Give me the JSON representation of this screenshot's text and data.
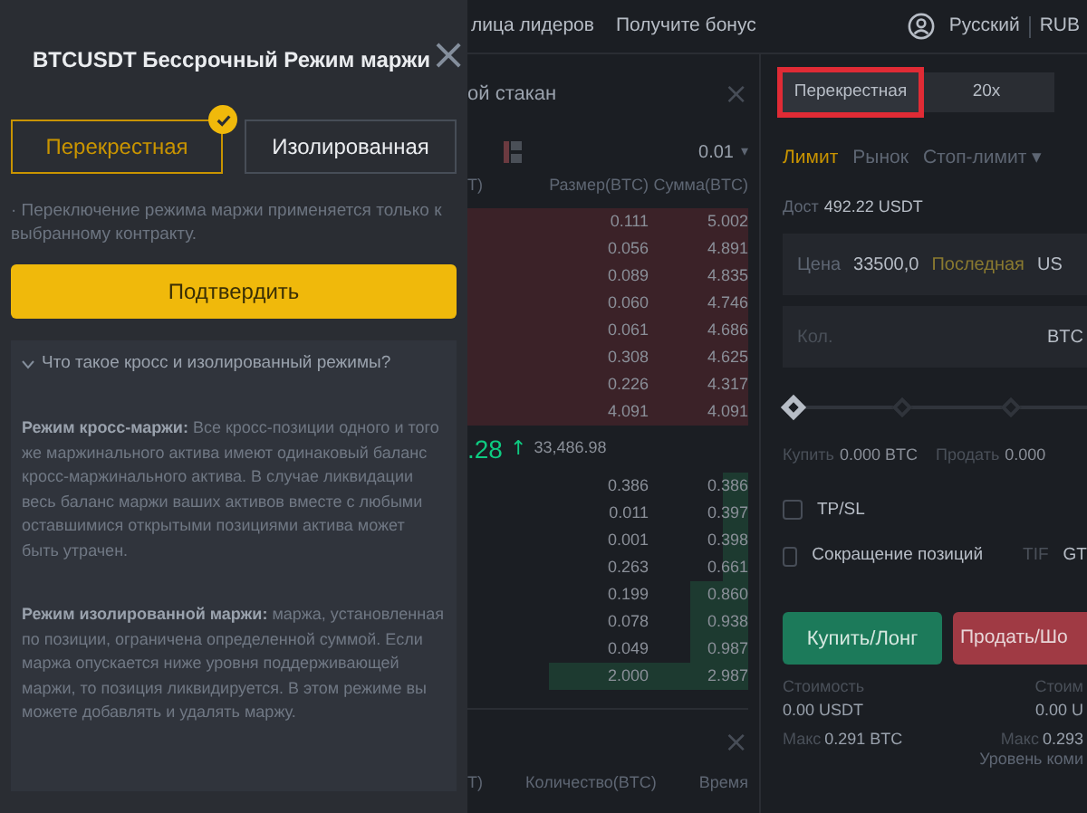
{
  "modal": {
    "title": "BTCUSDT Бессрочный Режим маржи",
    "close": "×",
    "options": [
      {
        "label": "Перекрестная",
        "selected": true
      },
      {
        "label": "Изолированная",
        "selected": false
      }
    ],
    "note": "· Переключение режима маржи применяется только к выбранному контракту.",
    "confirm_button": "Подтвердить",
    "faq": {
      "question": "Что такое кросс и изолированный режимы?",
      "expanded": true,
      "paragraphs": [
        "**Режим кросс-маржи:** Все кросс-позиции одного и того же маржинального актива имеют одинаковый баланс кросс-маржинального актива. В случае ликвидации весь баланс маржи ваших активов вместе с любыми оставшимися открытыми позициями актива может быть утрачен.",
        "**Режим изолированной маржи:** маржа, установленная по позиции, ограничена определенной суммой. Если маржа опускается ниже уровня поддерживающей маржи, то позиция ликвидируется. В этом режиме вы можете добавлять и удалять маржу."
      ]
    }
  },
  "nav": {
    "links": [
      "лица лидеров",
      "Получите бонус"
    ],
    "language": "Русский",
    "currency": "RUB"
  },
  "orderbook": {
    "title": "ой стакан",
    "close": "×",
    "precision": "0.01",
    "precision_caret": "▾",
    "columns": [
      "T)",
      "Размер(BTC)",
      "Сумма(BTC)"
    ],
    "asks": [
      {
        "size": "0.111",
        "total": "5.002"
      },
      {
        "size": "0.056",
        "total": "4.891"
      },
      {
        "size": "0.089",
        "total": "4.835"
      },
      {
        "size": "0.060",
        "total": "4.746"
      },
      {
        "size": "0.061",
        "total": "4.686"
      },
      {
        "size": "0.308",
        "total": "4.625"
      },
      {
        "size": "0.226",
        "total": "4.317"
      },
      {
        "size": "4.091",
        "total": "4.091"
      }
    ],
    "last_price": ".28",
    "arrow": "↑",
    "mark_price": "33,486.98",
    "bids": [
      {
        "size": "0.386",
        "total": "0.386"
      },
      {
        "size": "0.011",
        "total": "0.397"
      },
      {
        "size": "0.001",
        "total": "0.398"
      },
      {
        "size": "0.263",
        "total": "0.661"
      },
      {
        "size": "0.199",
        "total": "0.860"
      },
      {
        "size": "0.078",
        "total": "0.938"
      },
      {
        "size": "0.049",
        "total": "0.987"
      },
      {
        "size": "2.000",
        "total": "2.987"
      }
    ],
    "trades_close": "×",
    "trades_columns": [
      "T)",
      "Количество(BTC)",
      "Время"
    ]
  },
  "form": {
    "mode_tabs": [
      {
        "label": "Перекрестная",
        "highlighted": true
      },
      {
        "label": "20x",
        "highlighted": false
      }
    ],
    "order_types": [
      {
        "label": "Лимит",
        "selected": true
      },
      {
        "label": "Рынок",
        "selected": false
      },
      {
        "label": "Стоп-лимит ▾",
        "selected": false
      }
    ],
    "available_label": "Дост",
    "available_value": "492.22 USDT",
    "price_field": {
      "label": "Цена",
      "value": "33500,0",
      "tag": "Последная",
      "unit": "US"
    },
    "qty_field": {
      "label": "Кол.",
      "unit": "BTC"
    },
    "slider": {
      "level": 0
    },
    "buy_info": {
      "label": "Купить",
      "value": "0.000 BTC"
    },
    "sell_info": {
      "label": "Продать",
      "value": "0.000"
    },
    "checkboxes": [
      {
        "label": "TP/SL",
        "checked": false
      },
      {
        "label": "Сокращение позиций",
        "checked": false
      }
    ],
    "tif_label": "TIF",
    "tif_value": "GT",
    "buy_button": "Купить/Лонг",
    "sell_button": "Продать/Шо",
    "cost": [
      {
        "label": "Стоимость",
        "value": "0.00 USDT",
        "max_label": "Макс",
        "max_value": "0.291 BTC"
      },
      {
        "label": "Стоим",
        "value": "0.00 U",
        "max_label": "Макс",
        "max_value": "0.293"
      }
    ],
    "fee_level": "Уровень коми"
  }
}
